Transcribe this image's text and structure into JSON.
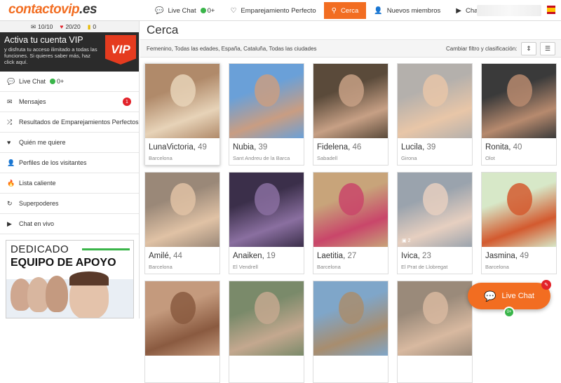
{
  "logo": {
    "main": "contactovip",
    "suffix": ".es"
  },
  "nav": [
    {
      "label": "Live Chat",
      "icon": "chat-bubbles-icon",
      "glyph": "💬",
      "count": "0+"
    },
    {
      "label": "Emparejamiento Perfecto",
      "icon": "heart-outline-icon",
      "glyph": "♡"
    },
    {
      "label": "Cerca",
      "icon": "location-pin-icon",
      "glyph": "⚲",
      "active": true
    },
    {
      "label": "Nuevos miembros",
      "icon": "user-icon",
      "glyph": "👤"
    },
    {
      "label": "Chat en vivo",
      "icon": "video-camera-icon",
      "glyph": "▶"
    }
  ],
  "stats": {
    "messages": "10/10",
    "hearts": "20/20",
    "coins": "0"
  },
  "vip": {
    "title": "Activa tu cuenta VIP",
    "text": "y disfruta tu acceso ilimitado a todas las funciones. Si quieres saber más, haz click aquí.",
    "badge": "VIP"
  },
  "menu": [
    {
      "label": "Live Chat",
      "icon": "chat-bubbles-icon",
      "glyph": "💬",
      "count": "0+"
    },
    {
      "label": "Mensajes",
      "icon": "envelope-icon",
      "glyph": "✉",
      "badge": "1"
    },
    {
      "label": "Resultados de Emparejamientos Perfectos",
      "icon": "shuffle-icon",
      "glyph": "⤮"
    },
    {
      "label": "Quién me quiere",
      "icon": "heart-icon",
      "glyph": "♥"
    },
    {
      "label": "Perfiles de los visitantes",
      "icon": "user-icon",
      "glyph": "👤"
    },
    {
      "label": "Lista caliente",
      "icon": "fire-icon",
      "glyph": "🔥"
    },
    {
      "label": "Superpoderes",
      "icon": "refresh-icon",
      "glyph": "↻"
    },
    {
      "label": "Chat en vivo",
      "icon": "video-camera-icon",
      "glyph": "▶"
    }
  ],
  "support": {
    "line1": "DEDICADO",
    "line2": "EQUIPO DE APOYO"
  },
  "main": {
    "title": "Cerca",
    "filter_text": "Femenino, Todas las edades, España, Cataluña, Todas las ciudades",
    "sort_label": "Cambiar filtro y clasificación:"
  },
  "profiles": [
    {
      "name": "LunaVictoria",
      "age": "49",
      "city": "Barcelona",
      "photo": "#b08a6a",
      "photo2": "#e7d3b8"
    },
    {
      "name": "Nubia",
      "age": "39",
      "city": "Sant Andreu de la Barca",
      "photo": "#6aa0d8",
      "photo2": "#c99d82"
    },
    {
      "name": "Fidelena",
      "age": "46",
      "city": "Sabadell",
      "photo": "#5a4a3a",
      "photo2": "#c7a085"
    },
    {
      "name": "Lucila",
      "age": "39",
      "city": "Girona",
      "photo": "#b4b0ac",
      "photo2": "#e8c6a8"
    },
    {
      "name": "Ronita",
      "age": "40",
      "city": "Olot",
      "photo": "#3a3a3a",
      "photo2": "#b78a6e"
    },
    {
      "name": "Amilé",
      "age": "44",
      "city": "Barcelona",
      "photo": "#9a8878",
      "photo2": "#e0c2a5"
    },
    {
      "name": "Anaiken",
      "age": "19",
      "city": "El Vendrell",
      "photo": "#3b2f4a",
      "photo2": "#8a6fa0"
    },
    {
      "name": "Laetitia",
      "age": "27",
      "city": "Barcelona",
      "photo": "#c8a47a",
      "photo2": "#c9466a"
    },
    {
      "name": "Ivica",
      "age": "23",
      "city": "El Prat de Llobregat",
      "photo": "#9aa3ad",
      "photo2": "#e6cfc0",
      "photo_count": "2"
    },
    {
      "name": "Jasmina",
      "age": "49",
      "city": "Barcelona",
      "photo": "#d7e8c8",
      "photo2": "#d35a2f"
    },
    {
      "name": "",
      "age": "",
      "city": "",
      "photo": "#c49a7d",
      "photo2": "#8a5a40"
    },
    {
      "name": "",
      "age": "",
      "city": "",
      "photo": "#7a8a6a",
      "photo2": "#c4a88f"
    },
    {
      "name": "",
      "age": "",
      "city": "",
      "photo": "#7fa6c9",
      "photo2": "#a88d6e"
    },
    {
      "name": "",
      "age": "",
      "city": "",
      "photo": "#9a8a7a",
      "photo2": "#d8b9a0"
    }
  ],
  "live_chat_float": {
    "label": "Live Chat",
    "count": "0+"
  }
}
